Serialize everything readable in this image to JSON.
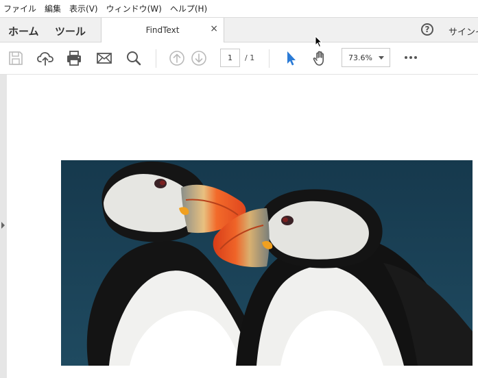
{
  "menu": [
    "ファイル",
    "編集",
    "表示(V)",
    "ウィンドウ(W)",
    "ヘルプ(H)"
  ],
  "tabs": {
    "home": "ホーム",
    "tools": "ツール",
    "document": "FindText",
    "close": "×"
  },
  "header": {
    "help": "?",
    "signin": "サインイ"
  },
  "toolbar": {
    "page_current": "1",
    "page_total": "/ 1",
    "zoom": "73.6%"
  },
  "icons": [
    "save-icon",
    "upload-cloud-icon",
    "print-icon",
    "email-icon",
    "search-icon",
    "previous-page-icon",
    "next-page-icon",
    "select-tool-icon",
    "hand-tool-icon",
    "more-icon"
  ],
  "colors": {
    "accent": "#2b7bd6",
    "tab_bar": "#f0f0f0",
    "icon_gray": "#555555",
    "icon_disabled": "#b9b9b9"
  },
  "document": {
    "image_subject": "two puffins"
  }
}
